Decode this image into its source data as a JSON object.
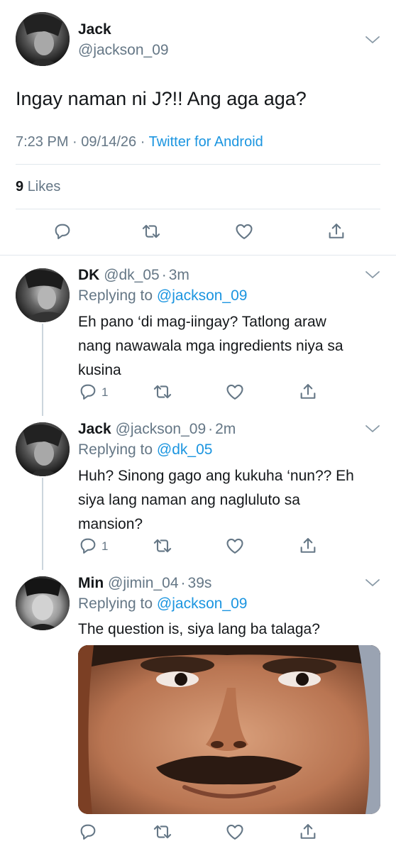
{
  "main_tweet": {
    "name": "Jack",
    "handle": "@jackson_09",
    "text": "Ingay naman ni J?!! Ang aga aga?",
    "time": "7:23 PM",
    "sep1": "·",
    "date": "09/14/26",
    "sep2": "·",
    "source": "Twitter for Android",
    "likes_count": "9",
    "likes_label": "Likes"
  },
  "replies": [
    {
      "name": "DK",
      "handle": "@dk_05",
      "sep": "·",
      "age": "3m",
      "replying_label": "Replying to",
      "replying_to": "@jackson_09",
      "text_lines": [
        "Eh pano ‘di mag-iingay? Tatlong araw",
        "nang nawawala mga ingredients niya sa",
        "kusina"
      ],
      "reply_count": "1"
    },
    {
      "name": "Jack",
      "handle": "@jackson_09",
      "sep": "·",
      "age": "2m",
      "replying_label": "Replying to",
      "replying_to": "@dk_05",
      "text_lines": [
        "Huh? Sinong gago ang kukuha ‘nun?? Eh",
        "siya lang naman ang nagluluto sa",
        "mansion?"
      ],
      "reply_count": "1"
    },
    {
      "name": "Min",
      "handle": "@jimin_04",
      "sep": "·",
      "age": "39s",
      "replying_label": "Replying to",
      "replying_to": "@jackson_09",
      "text_lines": [
        "The question is, siya lang ba talaga?"
      ],
      "reply_count": ""
    }
  ],
  "icons": {
    "reply": "reply-icon",
    "retweet": "retweet-icon",
    "like": "heart-icon",
    "share": "share-icon",
    "more": "chevron-down-icon"
  },
  "colors": {
    "link": "#1b95e0",
    "secondary": "#657786",
    "icon": "#657786",
    "divider": "#e1e8ed"
  }
}
